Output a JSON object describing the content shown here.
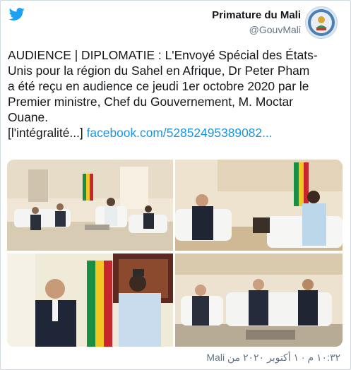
{
  "author": {
    "name": "Primature du Mali",
    "handle": "@GouvMali"
  },
  "tweet": {
    "lines": [
      "AUDIENCE | DIPLOMATIE : L'Envoyé Spécial des États-",
      "Unis pour la région du Sahel en Afrique, Dr Peter Pham",
      "a été reçu en audience ce jeudi 1er octobre 2020 par le",
      "Premier ministre, Chef du Gouvernement, M. Moctar",
      "Ouane."
    ],
    "more_prefix": "[l'intégralité...] ",
    "link": "facebook.com/52852495389082..."
  },
  "timestamp": "١٠:٣٢ م · ١ أكتوبر ٢٠٢٠ من Mali",
  "colors": {
    "twitter_blue": "#1da1f2",
    "link": "#1b95e0",
    "text": "#14171a",
    "muted": "#657786"
  },
  "icons": [
    "twitter-bird-icon"
  ]
}
